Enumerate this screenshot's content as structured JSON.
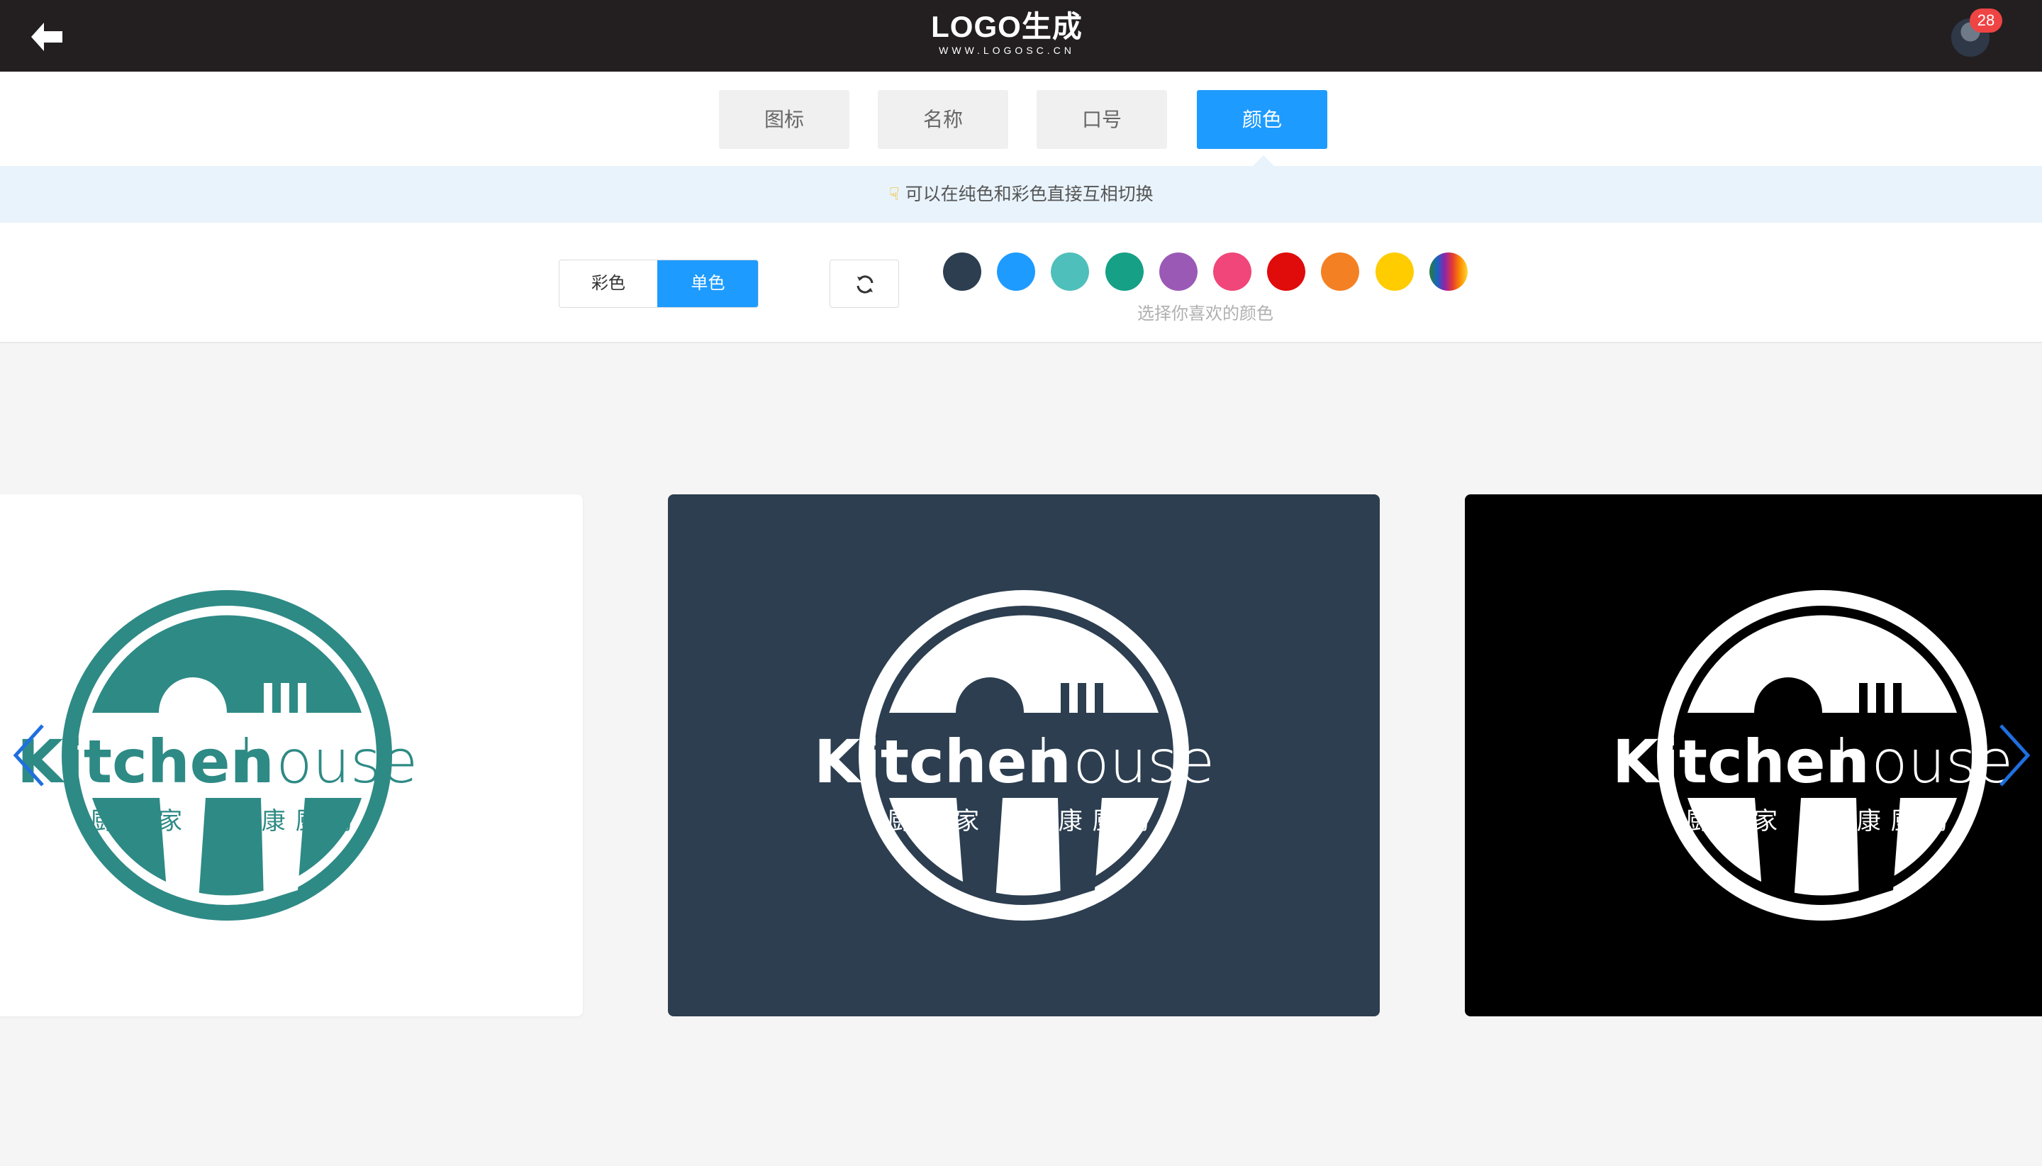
{
  "header": {
    "brand_title": "LOGO生成",
    "brand_url": "WWW.LOGOSC.CN",
    "notification_count": "28"
  },
  "tabs": [
    {
      "label": "图标",
      "active": false
    },
    {
      "label": "名称",
      "active": false
    },
    {
      "label": "口号",
      "active": false
    },
    {
      "label": "颜色",
      "active": true
    }
  ],
  "hint": {
    "text": "可以在纯色和彩色直接互相切换"
  },
  "color_mode": {
    "multi_label": "彩色",
    "mono_label": "单色",
    "selected": "单色"
  },
  "palette": {
    "caption": "选择你喜欢的颜色",
    "colors": [
      "#2c3e50",
      "#1e9bff",
      "#4fbfbb",
      "#16a085",
      "#9b59b6",
      "#f0467a",
      "#e00b0b",
      "#f48024",
      "#ffcc00",
      "rainbow"
    ]
  },
  "logo": {
    "name_bold": "Kitchen",
    "name_light": "house",
    "slogan": "厨之家  健康厨房"
  },
  "previews": [
    {
      "background": "#ffffff",
      "logo_color": "#2e8a85"
    },
    {
      "background": "#2c3e50",
      "logo_color": "#ffffff"
    },
    {
      "background": "#000000",
      "logo_color": "#ffffff"
    }
  ],
  "colors": {
    "accent": "#1e9bff",
    "topbar": "#231f20",
    "arrow": "#1e6fe0"
  }
}
